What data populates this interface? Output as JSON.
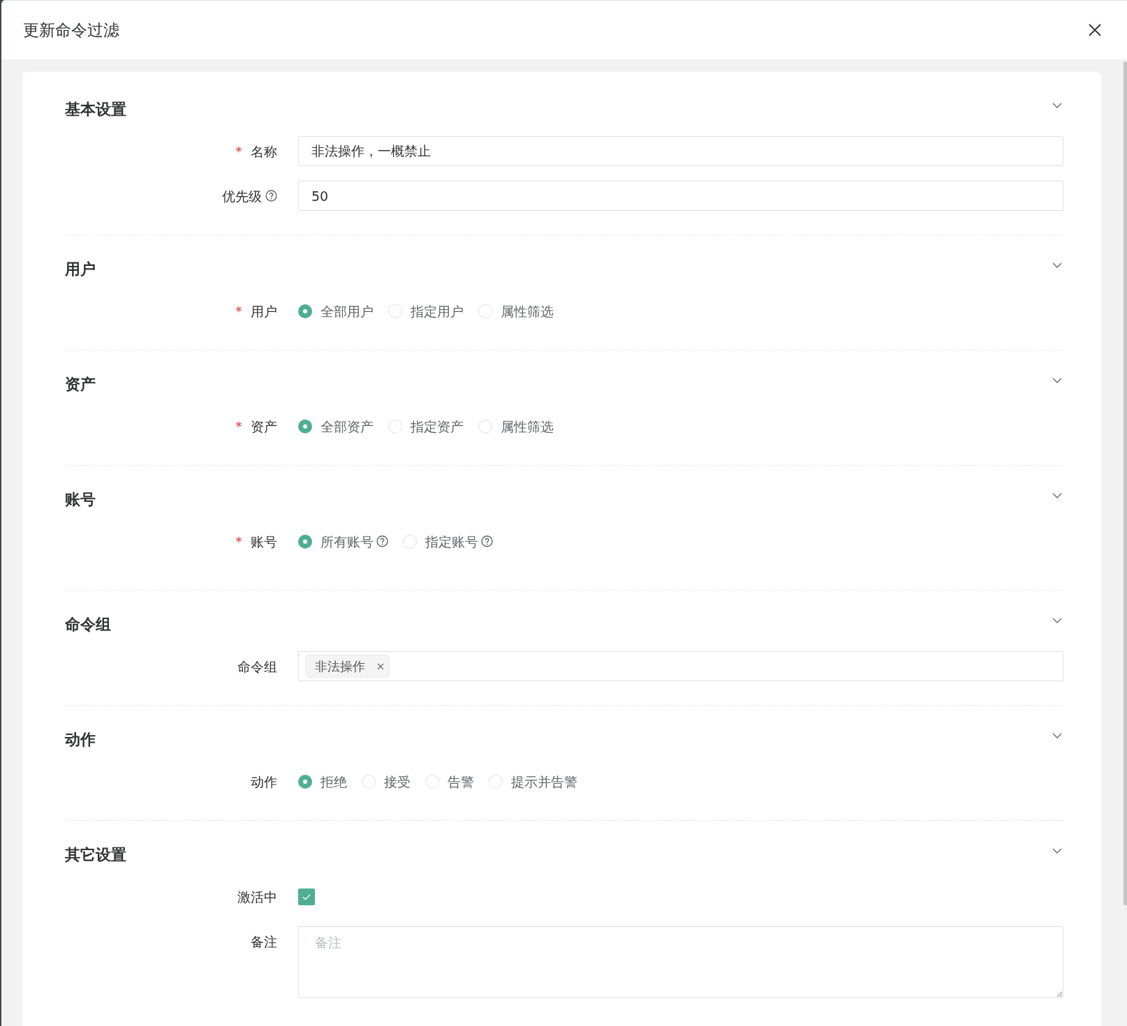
{
  "drawer": {
    "title": "更新命令过滤"
  },
  "sections": [
    {
      "title": "基本设置",
      "expanded": true,
      "fields": [
        {
          "kind": "text",
          "label": "名称",
          "required": true,
          "help": false,
          "value": "非法操作，一概禁止"
        },
        {
          "kind": "text",
          "label": "优先级",
          "required": false,
          "help": true,
          "value": "50"
        }
      ]
    },
    {
      "title": "用户",
      "expanded": true,
      "fields": [
        {
          "kind": "radio",
          "label": "用户",
          "required": true,
          "help": false,
          "options": [
            {
              "label": "全部用户",
              "selected": true
            },
            {
              "label": "指定用户",
              "selected": false
            },
            {
              "label": "属性筛选",
              "selected": false
            }
          ]
        }
      ]
    },
    {
      "title": "资产",
      "expanded": true,
      "fields": [
        {
          "kind": "radio",
          "label": "资产",
          "required": true,
          "help": false,
          "options": [
            {
              "label": "全部资产",
              "selected": true
            },
            {
              "label": "指定资产",
              "selected": false
            },
            {
              "label": "属性筛选",
              "selected": false
            }
          ]
        }
      ]
    },
    {
      "title": "账号",
      "expanded": true,
      "fields": [
        {
          "kind": "radio",
          "label": "账号",
          "required": true,
          "help": false,
          "options": [
            {
              "label": "所有账号",
              "help": true,
              "selected": true
            },
            {
              "label": "指定账号",
              "help": true,
              "selected": false
            }
          ]
        }
      ]
    },
    {
      "title": "命令组",
      "expanded": true,
      "fields": [
        {
          "kind": "tags",
          "label": "命令组",
          "required": false,
          "help": false,
          "tags": [
            "非法操作"
          ]
        }
      ]
    },
    {
      "title": "动作",
      "expanded": true,
      "fields": [
        {
          "kind": "radio",
          "label": "动作",
          "required": false,
          "help": false,
          "options": [
            {
              "label": "拒绝",
              "selected": true
            },
            {
              "label": "接受",
              "selected": false
            },
            {
              "label": "告警",
              "selected": false
            },
            {
              "label": "提示并告警",
              "selected": false
            }
          ]
        }
      ]
    },
    {
      "title": "其它设置",
      "expanded": true,
      "fields": [
        {
          "kind": "checkbox",
          "label": "激活中",
          "required": false,
          "help": false,
          "checked": true
        },
        {
          "kind": "textarea",
          "label": "备注",
          "required": false,
          "help": false,
          "placeholder": "备注"
        }
      ]
    }
  ]
}
